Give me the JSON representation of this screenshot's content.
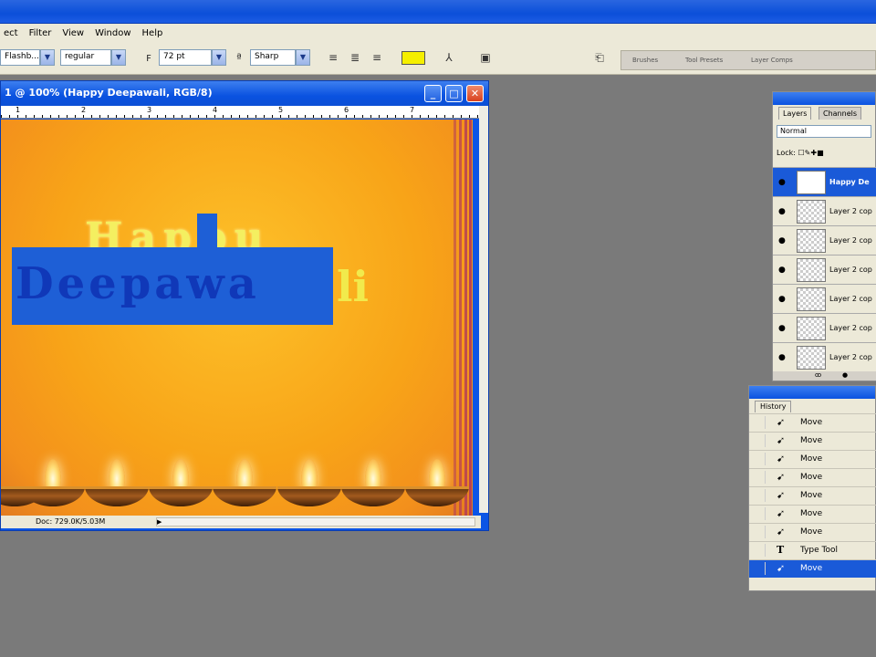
{
  "menu": [
    "ect",
    "Filter",
    "View",
    "Window",
    "Help"
  ],
  "options": {
    "font_family": "Flashb...",
    "font_style": "regular",
    "font_size": "72 pt",
    "antialias": "Sharp",
    "color": "#f5ef00"
  },
  "palette_well": [
    "Brushes",
    "Tool Presets",
    "Layer Comps"
  ],
  "document": {
    "title": "1 @ 100% (Happy Deepawali, RGB/8)",
    "ruler_numbers": [
      "1",
      "2",
      "3",
      "4",
      "5",
      "6",
      "7"
    ],
    "canvas_text_happy": "Happu",
    "canvas_text_deep": "Deepawa",
    "canvas_text_li": "li",
    "status": "Doc: 729.0K/5.03M"
  },
  "layers": {
    "tabs": [
      "Layers",
      "Channels"
    ],
    "blend_mode": "Normal",
    "lock_label": "Lock:",
    "items": [
      {
        "name": "Happy De",
        "selected": true
      },
      {
        "name": "Layer 2 cop",
        "selected": false
      },
      {
        "name": "Layer 2 cop",
        "selected": false
      },
      {
        "name": "Layer 2 cop",
        "selected": false
      },
      {
        "name": "Layer 2 cop",
        "selected": false
      },
      {
        "name": "Layer 2 cop",
        "selected": false
      },
      {
        "name": "Layer 2 cop",
        "selected": false
      }
    ]
  },
  "history": {
    "tab": "History",
    "items": [
      "Move",
      "Move",
      "Move",
      "Move",
      "Move",
      "Move",
      "Move",
      "Type Tool",
      "Move"
    ],
    "selected_index": 8
  }
}
